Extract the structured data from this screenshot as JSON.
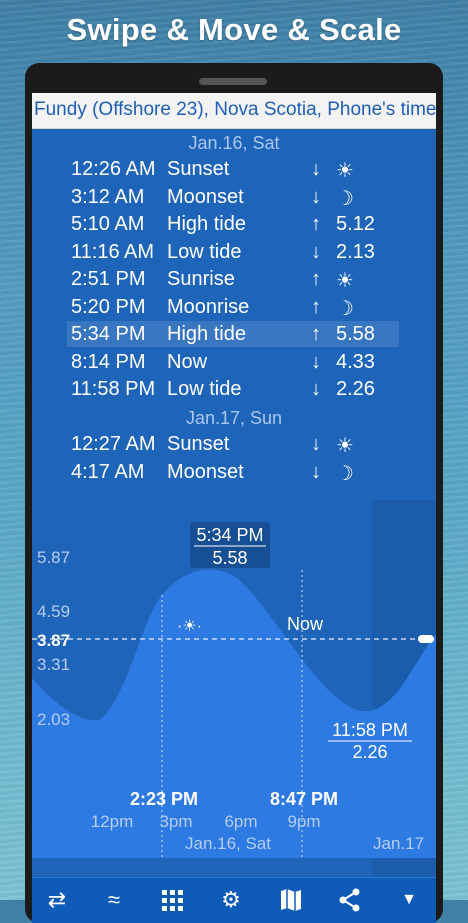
{
  "headline": "Swipe & Move & Scale",
  "location_title": "Fundy (Offshore 23), Nova Scotia, Phone's time",
  "days": [
    {
      "date": "Jan.16, Sat",
      "events": [
        {
          "time": "12:26 AM",
          "event": "Sunset",
          "arrow": "↓",
          "value": "☀"
        },
        {
          "time": "3:12 AM",
          "event": "Moonset",
          "arrow": "↓",
          "value": "☽"
        },
        {
          "time": "5:10 AM",
          "event": "High tide",
          "arrow": "↑",
          "value": "5.12"
        },
        {
          "time": "11:16 AM",
          "event": "Low tide",
          "arrow": "↓",
          "value": "2.13"
        },
        {
          "time": "2:51 PM",
          "event": "Sunrise",
          "arrow": "↑",
          "value": "☀"
        },
        {
          "time": "5:20 PM",
          "event": "Moonrise",
          "arrow": "↑",
          "value": "☽"
        },
        {
          "time": "5:34 PM",
          "event": "High tide",
          "arrow": "↑",
          "value": "5.58"
        },
        {
          "time": "8:14 PM",
          "event": "Now",
          "arrow": "↓",
          "value": "4.33"
        },
        {
          "time": "11:58 PM",
          "event": "Low tide",
          "arrow": "↓",
          "value": "2.26"
        }
      ]
    },
    {
      "date": "Jan.17, Sun",
      "events": [
        {
          "time": "12:27 AM",
          "event": "Sunset",
          "arrow": "↓",
          "value": "☀"
        },
        {
          "time": "4:17 AM",
          "event": "Moonset",
          "arrow": "↓",
          "value": "☽"
        }
      ]
    }
  ],
  "chart": {
    "y_labels": [
      "5.87",
      "4.59",
      "3.87",
      "3.31",
      "2.03"
    ],
    "high_label_time": "5:34 PM",
    "high_label_value": "5.58",
    "low_label_time": "11:58 PM",
    "low_label_value": "2.26",
    "now_label": "Now",
    "day_start_label": "2:23 PM",
    "day_end_label": "8:47 PM",
    "x_labels": [
      "12pm",
      "3pm",
      "6pm",
      "9pm"
    ],
    "date_label": "Jan.16, Sat",
    "next_date_label": "Jan.17"
  },
  "toolbar": {
    "icons": [
      "swap-arrows-icon",
      "waves-icon",
      "grid-icon",
      "gear-icon",
      "map-icon",
      "share-icon",
      "chevron-down-icon"
    ]
  },
  "colors": {
    "screen_bg": "#1e64b9",
    "wave_fill": "#2d7ae3",
    "title_text": "#1e5fb5"
  }
}
